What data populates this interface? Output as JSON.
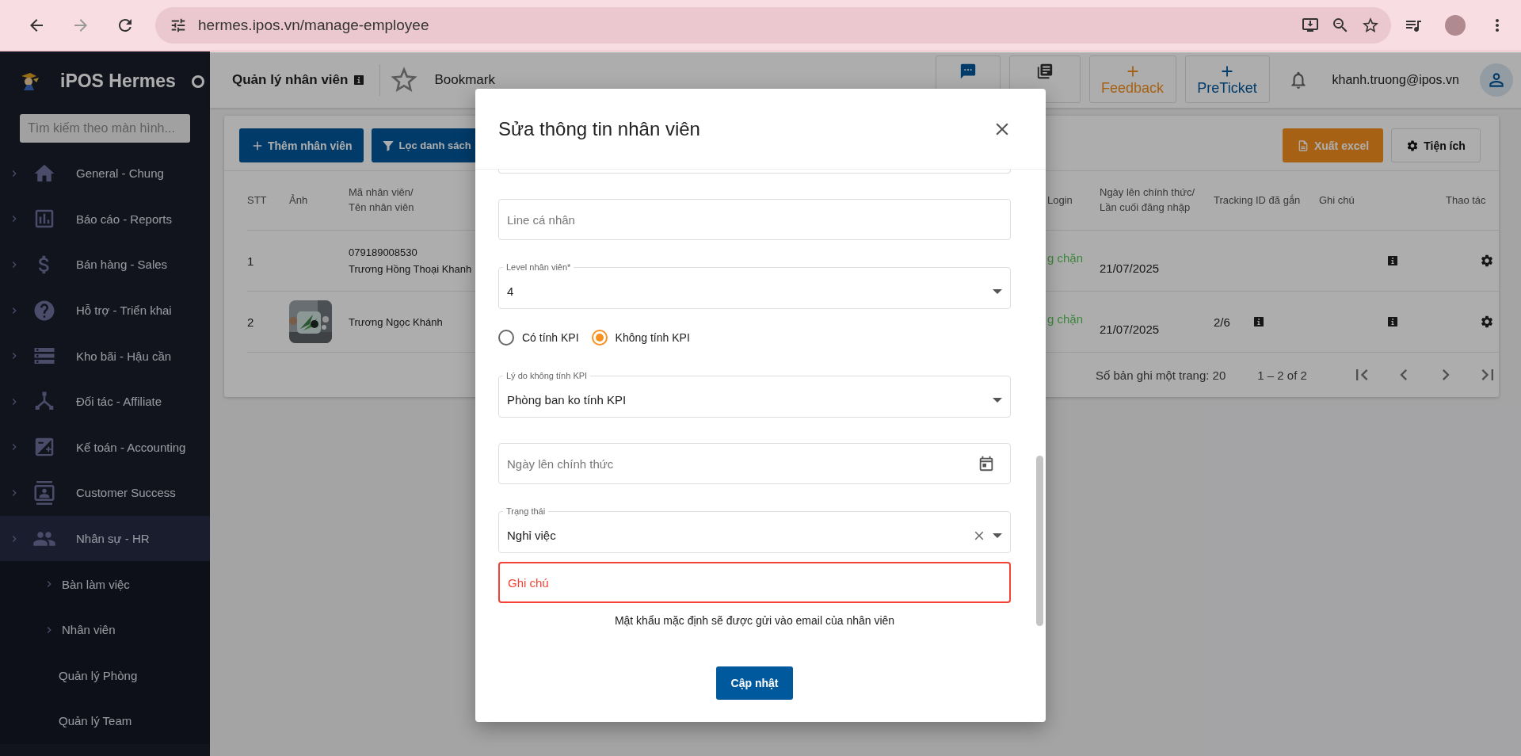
{
  "browser": {
    "url": "hermes.ipos.vn/manage-employee"
  },
  "sidebar": {
    "brand": "iPOS Hermes",
    "search_placeholder": "Tìm kiếm theo màn hình...",
    "items": [
      {
        "kind": "home",
        "label": "General - Chung"
      },
      {
        "kind": "report",
        "label": "Báo cáo - Reports"
      },
      {
        "kind": "sales",
        "label": "Bán hàng - Sales"
      },
      {
        "kind": "help",
        "label": "Hỗ trợ - Triển khai"
      },
      {
        "kind": "storage",
        "label": "Kho bãi - Hậu cần"
      },
      {
        "kind": "affiliate",
        "label": "Đối tác - Affiliate"
      },
      {
        "kind": "accounting",
        "label": "Kế toán - Accounting"
      },
      {
        "kind": "customer",
        "label": "Customer Success"
      },
      {
        "kind": "people",
        "label": "Nhân sự - HR",
        "expanded": true,
        "children": [
          {
            "label": "Bàn làm việc",
            "expandable": true
          },
          {
            "label": "Nhân viên",
            "expandable": true
          },
          {
            "label": "Quản lý Phòng",
            "expandable": false
          },
          {
            "label": "Quản lý Team",
            "expandable": false
          }
        ]
      }
    ]
  },
  "header": {
    "title": "Quản lý nhân viên",
    "bookmark": "Bookmark",
    "actions": [
      {
        "kind": "chat"
      },
      {
        "kind": "books"
      },
      {
        "kind": "feedback",
        "label": "Feedback"
      },
      {
        "kind": "ticket",
        "label": "PreTicket"
      }
    ],
    "user": "khanh.truong@ipos.vn"
  },
  "table": {
    "toolbar": {
      "add": "Thêm nhân viên",
      "filter": "Lọc danh sách",
      "export": "Xuất excel",
      "utilities": "Tiện ích"
    },
    "columns": [
      "STT",
      "Ảnh",
      "Mã nhân viên/\nTên nhân viên",
      "Login",
      "Ngày lên chính thức/\nLần cuối đăng nhập",
      "Tracking ID đã gắn",
      "Ghi chú",
      "Thao tác"
    ],
    "rows": [
      {
        "stt": "1",
        "code": "079189008530",
        "name": "Trương Hồng Thoại Khanh",
        "status": "g chặn",
        "date": "21/07/2025",
        "note_info": true
      },
      {
        "stt": "2",
        "name": "Trương Ngọc Khánh",
        "status": "g chặn",
        "date": "21/07/2025",
        "tracking": "2/6",
        "note_info": true
      }
    ],
    "footer": {
      "page_size": "Số bản ghi một trang: 20",
      "range": "1 – 2 of 2"
    }
  },
  "dialog": {
    "title": "Sửa thông tin nhân viên",
    "fields": [
      {
        "kind": "text",
        "placeholder": "Line cá nhân"
      },
      {
        "kind": "select",
        "label": "Level nhân viên*",
        "value": "4"
      },
      {
        "kind": "radio",
        "options": [
          {
            "label": "Có tính KPI",
            "selected": false
          },
          {
            "label": "Không tính KPI",
            "selected": true
          }
        ]
      },
      {
        "kind": "select",
        "label": "Lý do không tính KPI",
        "value": "Phòng ban ko tính KPI"
      },
      {
        "kind": "date",
        "placeholder": "Ngày lên chính thức"
      },
      {
        "kind": "select",
        "label": "Trạng thái",
        "value": "Nghỉ việc",
        "clearable": true
      },
      {
        "kind": "text",
        "placeholder": "Ghi chú",
        "error": true
      }
    ],
    "note": "Mật khẩu mặc định sẽ được gửi vào email của nhân viên",
    "submit": "Cập nhật"
  }
}
